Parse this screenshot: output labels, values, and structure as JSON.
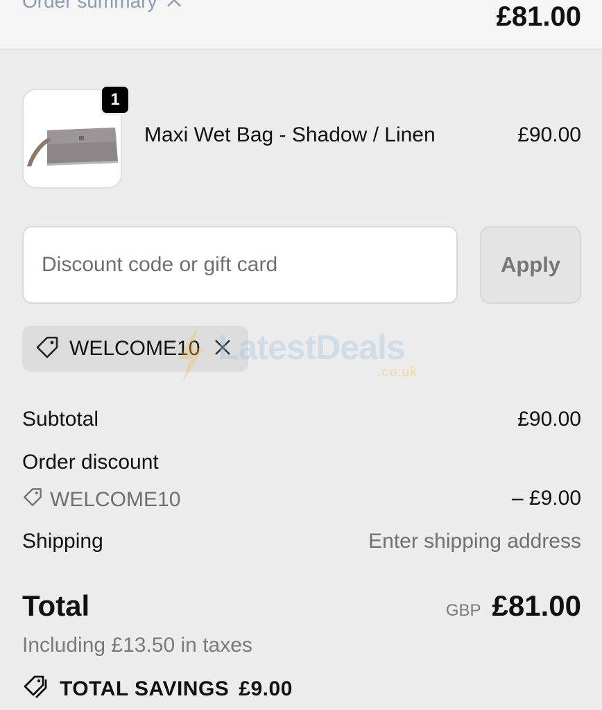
{
  "header": {
    "summary_label": "Order summary",
    "total": "£81.00"
  },
  "product": {
    "quantity": "1",
    "name": "Maxi Wet Bag - Shadow / Linen",
    "price": "£90.00",
    "image_icon": "clutch-bag-image"
  },
  "discount": {
    "placeholder": "Discount code or gift card",
    "apply_label": "Apply",
    "applied_code": "WELCOME10"
  },
  "watermark": {
    "brand": "LatestDeals",
    "sub": ".co.uk"
  },
  "summary": {
    "subtotal_label": "Subtotal",
    "subtotal_value": "£90.00",
    "order_discount_label": "Order discount",
    "discount_code": "WELCOME10",
    "discount_value": "– £9.00",
    "shipping_label": "Shipping",
    "shipping_value": "Enter shipping address",
    "total_label": "Total",
    "currency": "GBP",
    "total_value": "£81.00",
    "tax_note": "Including £13.50 in taxes",
    "savings_label": "TOTAL SAVINGS",
    "savings_value": "£9.00"
  },
  "colors": {
    "background": "#ececec",
    "muted_text": "#6f6f6f",
    "badge": "#000000"
  }
}
